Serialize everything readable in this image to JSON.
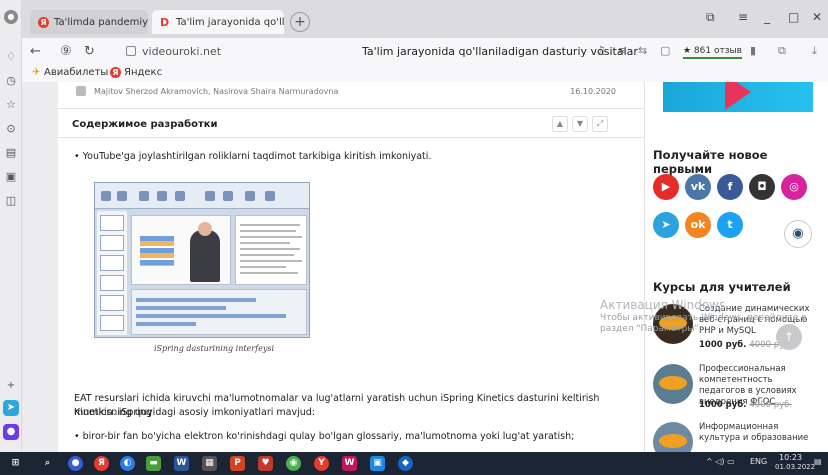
{
  "browser": {
    "tabs": [
      {
        "title": "Ta'limda pandemiyaning",
        "active": false
      },
      {
        "title": "Ta'lim jarayonida qo'llan",
        "active": true
      }
    ],
    "new_tab": "+",
    "window_controls": [
      "⧉",
      "≡",
      "_",
      "□",
      "✕"
    ],
    "address": {
      "url": "videouroki.net",
      "page_title": "Ta'lim jarayonida qo'llaniladigan dasturiy vositalar",
      "reviews": "★ 861 отзыв"
    },
    "bookmarks": [
      "Авиабилеты",
      "Яндекс"
    ]
  },
  "article": {
    "authors": "Majitov Sherzod Akramovich, Nasirova Shaira Narmuradovna",
    "date": "16.10.2020",
    "section_title": "Содержимое разработки",
    "bullet1": "• YouTube'ga joylashtirilgan roliklarni taqdimot tarkibiga kiritish imkoniyati.",
    "image_caption": "iSpring dasturining interfeysi",
    "para1_line1": "EAT resurslari ichida kiruvchi ma'lumotnomalar va lug'atlarni yaratish uchun iSpring Kinetics dasturini keltirish mumkin. iSpring",
    "para1_line2": "Kineticsning quyidagi asosiy imkoniyatlari mavjud:",
    "bullet2": "• biror-bir fan bo'yicha elektron ko'rinishdagi qulay bo'lgan glossariy, ma'lumotnoma yoki lug'at yaratish;"
  },
  "sidebar": {
    "subscribe_title": "Получайте новое первыми",
    "social": [
      {
        "name": "youtube",
        "glyph": "▶",
        "color": "#e52d27"
      },
      {
        "name": "vk",
        "glyph": "vk",
        "color": "#4a76a8"
      },
      {
        "name": "facebook",
        "glyph": "f",
        "color": "#3b5998"
      },
      {
        "name": "odnoklassniki-alt",
        "glyph": "◘",
        "color": "#333333"
      },
      {
        "name": "instagram",
        "glyph": "◎",
        "color": "#d6249f"
      },
      {
        "name": "telegram",
        "glyph": "➤",
        "color": "#2aa3df"
      },
      {
        "name": "odnoklassniki",
        "glyph": "ok",
        "color": "#f48420"
      },
      {
        "name": "twitter",
        "glyph": "t",
        "color": "#1da1f2"
      }
    ],
    "courses_title": "Курсы для учителей",
    "courses": [
      {
        "title": "Создание динамических веб-страниц с помощью PHP и MySQL",
        "price": "1000 руб.",
        "old_price": "4000 руб."
      },
      {
        "title": "Профессиональная компетентность педагогов в условиях внедрения ФГОС",
        "price": "1000 руб.",
        "old_price": "4000 руб."
      },
      {
        "title": "Информационная культура и образование"
      }
    ]
  },
  "windows_watermark": {
    "title": "Активация Windows",
    "line1": "Чтобы активировать Windows, перейдите в",
    "line2": "раздел \"Параметры\"."
  },
  "taskbar": {
    "lang": "ENG",
    "time": "10:23",
    "date": "01.03.2022"
  }
}
